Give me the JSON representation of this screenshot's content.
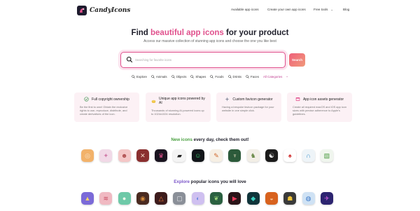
{
  "header": {
    "logo_text": "CandyIcons",
    "nav": [
      {
        "label": "Available app icons"
      },
      {
        "label": "Create your own app icons"
      },
      {
        "label": "Free tools"
      },
      {
        "label": "Blog"
      }
    ]
  },
  "hero": {
    "title_prefix": "Find ",
    "title_highlight": "beautiful app icons",
    "title_suffix": " for your product",
    "subtitle": "Access our massive collection of stunning app icons and choose the one you like best"
  },
  "search": {
    "placeholder": "Searching for favorite icons",
    "button_label": "Search"
  },
  "categories": [
    "Explore",
    "Animals",
    "Objects",
    "Shapes",
    "Foods",
    "Drinks",
    "Faces"
  ],
  "all_categories_label": "All Categories",
  "features": [
    {
      "title": "Full copyright ownership",
      "icon": "check-circle-icon",
      "description": "Be the first to own! Obtain the exclusive rights to use, reproduce, distribute, and create derivatives of the icon."
    },
    {
      "title": "Unique app icons powered by AI",
      "icon": "coin-icon",
      "description": "Thousands of stunning AI-powered icons up to 1024x1024 resolution."
    },
    {
      "title": "Custom favicon generator",
      "icon": "sparkle-icon",
      "description": "Having a bespoke favicon package for your website in one simple click."
    },
    {
      "title": "App icon assets generator",
      "icon": "app-window-icon",
      "description": "Create all required macOS and iOS app icon sizes with precise adherence to Apple's guidelines."
    }
  ],
  "new_section": {
    "highlight": "New icons",
    "rest": " every day, check them out!"
  },
  "explore_section": {
    "highlight": "Explore",
    "rest": " popular icons you will love"
  },
  "new_icons": [
    {
      "name": "ring-icon",
      "bg": "#f2b26a",
      "fg": "#f7e2c8",
      "glyph": "◎"
    },
    {
      "name": "unicorn-icon",
      "bg": "#f1d9e7",
      "fg": "#d07aa8",
      "glyph": "✦"
    },
    {
      "name": "bear-face-icon",
      "bg": "#f4c7c7",
      "fg": "#b05050",
      "glyph": "☻"
    },
    {
      "name": "bone-icon",
      "bg": "#8a2f2f",
      "fg": "#f3d8c8",
      "glyph": "✕"
    },
    {
      "name": "robot-pink-icon",
      "bg": "#1a1420",
      "fg": "#e0508c",
      "glyph": "♛"
    },
    {
      "name": "cow-icon",
      "bg": "#f4f4f4",
      "fg": "#222222",
      "glyph": "▰"
    },
    {
      "name": "grin-face-icon",
      "bg": "#12161a",
      "fg": "#3bd16f",
      "glyph": "☺"
    },
    {
      "name": "feathers-icon",
      "bg": "#f6efe4",
      "fg": "#d0672c",
      "glyph": "✎"
    },
    {
      "name": "fairy-icon",
      "bg": "#2c5a3a",
      "fg": "#f2e6c8",
      "glyph": "♆"
    },
    {
      "name": "llama-icon",
      "bg": "#f2eee6",
      "fg": "#6b8a4a",
      "glyph": "♞"
    },
    {
      "name": "glasses-icon",
      "bg": "#1a1a1a",
      "fg": "#f0f0f0",
      "glyph": "☯"
    },
    {
      "name": "mushroom-icon",
      "bg": "#ffffff",
      "fg": "#d03030",
      "glyph": "♠"
    },
    {
      "name": "blue-swirl-icon",
      "bg": "#eef4f8",
      "fg": "#2a8ac8",
      "glyph": "∩"
    },
    {
      "name": "green-cube-icon",
      "bg": "#f0f6ee",
      "fg": "#4a9a40",
      "glyph": "▧"
    }
  ],
  "explore_icons": [
    {
      "name": "prism-icon",
      "bg": "#7b6ad8",
      "fg": "#f5d36a",
      "glyph": "▲"
    },
    {
      "name": "sandwich-icon",
      "bg": "#f0b9c2",
      "fg": "#c84a60",
      "glyph": "≋"
    },
    {
      "name": "stones-icon",
      "bg": "#6ec9a8",
      "fg": "#f0f7ec",
      "glyph": "●"
    },
    {
      "name": "tire-icon",
      "bg": "#4a2a20",
      "fg": "#d48a3a",
      "glyph": "◉"
    },
    {
      "name": "triangle-sunset-icon",
      "bg": "#3d1c1c",
      "fg": "#ef7d3a",
      "glyph": "△"
    },
    {
      "name": "gray-frame-icon",
      "bg": "#8a8f98",
      "fg": "#e6e8ec",
      "glyph": "▢"
    },
    {
      "name": "gradient-blob-icon",
      "bg": "#cfc0f0",
      "fg": "#6a8ae0",
      "glyph": "◐"
    },
    {
      "name": "leaf-icon",
      "bg": "#2a6040",
      "fg": "#9ad27a",
      "glyph": "❦"
    },
    {
      "name": "play-red-icon",
      "bg": "#2a1418",
      "fg": "#e83a5a",
      "glyph": "▶"
    },
    {
      "name": "teal-gem-icon",
      "bg": "#10343a",
      "fg": "#3ad0c0",
      "glyph": "◆"
    },
    {
      "name": "orange-bowl-icon",
      "bg": "#d8621e",
      "fg": "#f6c69a",
      "glyph": "◒"
    },
    {
      "name": "pixel-face-icon",
      "bg": "#3a3a3a",
      "fg": "#f2c438",
      "glyph": "☗"
    },
    {
      "name": "circle-stack-icon",
      "bg": "#cfe2f4",
      "fg": "#3a78c8",
      "glyph": "◍"
    },
    {
      "name": "space-rocket-icon",
      "bg": "#2c2470",
      "fg": "#c85ad8",
      "glyph": "✈"
    }
  ]
}
